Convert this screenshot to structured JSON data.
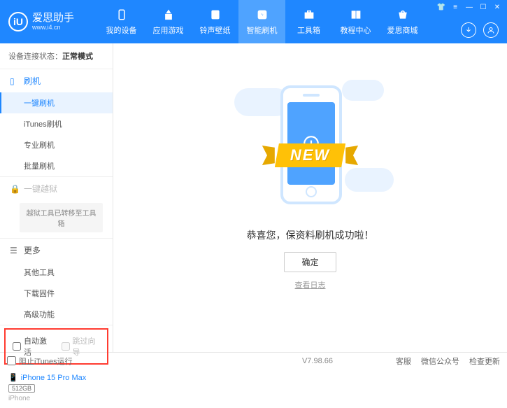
{
  "app": {
    "name": "爱思助手",
    "url": "www.i4.cn",
    "logo_letter": "iU"
  },
  "nav": {
    "tabs": [
      {
        "label": "我的设备",
        "icon": "device"
      },
      {
        "label": "应用游戏",
        "icon": "app"
      },
      {
        "label": "铃声壁纸",
        "icon": "ringtone"
      },
      {
        "label": "智能刷机",
        "icon": "flash",
        "active": true
      },
      {
        "label": "工具箱",
        "icon": "toolbox"
      },
      {
        "label": "教程中心",
        "icon": "tutorial"
      },
      {
        "label": "爱思商城",
        "icon": "store"
      }
    ]
  },
  "device_status": {
    "label": "设备连接状态：",
    "value": "正常模式"
  },
  "sidebar": {
    "flash": {
      "header": "刷机",
      "items": [
        "一键刷机",
        "iTunes刷机",
        "专业刷机",
        "批量刷机"
      ]
    },
    "jailbreak": {
      "header": "一键越狱",
      "note": "越狱工具已转移至工具箱"
    },
    "more": {
      "header": "更多",
      "items": [
        "其他工具",
        "下载固件",
        "高级功能"
      ]
    },
    "checkboxes": {
      "auto_activate": "自动激活",
      "skip_guide": "跳过向导"
    }
  },
  "device": {
    "name": "iPhone 15 Pro Max",
    "storage": "512GB",
    "type": "iPhone"
  },
  "main": {
    "ribbon": "NEW",
    "success": "恭喜您，保资料刷机成功啦！",
    "ok": "确定",
    "log": "查看日志"
  },
  "footer": {
    "block_itunes": "阻止iTunes运行",
    "version": "V7.98.66",
    "links": [
      "客服",
      "微信公众号",
      "检查更新"
    ]
  }
}
